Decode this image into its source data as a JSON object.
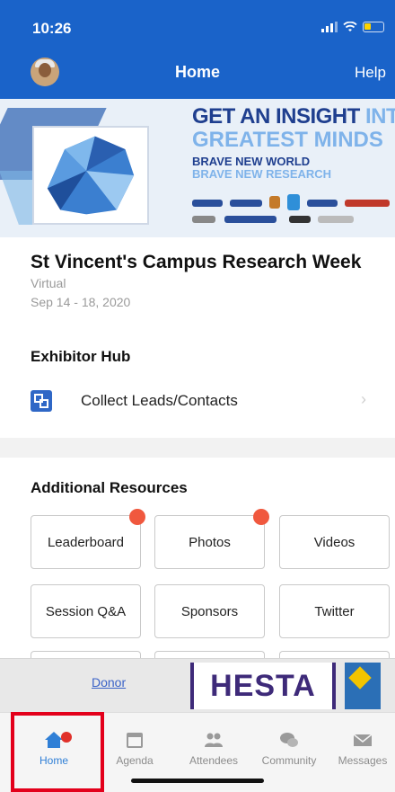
{
  "status_bar": {
    "time": "10:26"
  },
  "nav": {
    "title": "Home",
    "help_label": "Help"
  },
  "banner": {
    "line1_bold": "GET AN INSIGHT",
    "line1_light": "INTO OUR",
    "line2": "GREATEST MINDS",
    "line3": "BRAVE NEW WORLD",
    "line4": "BRAVE NEW RESEARCH"
  },
  "event": {
    "title": "St Vincent's Campus Research Week",
    "type": "Virtual",
    "date": "Sep 14 - 18, 2020"
  },
  "exhibitor_hub": {
    "title": "Exhibitor Hub",
    "collect_leads_label": "Collect Leads/Contacts"
  },
  "additional_resources": {
    "title": "Additional Resources",
    "buttons": [
      {
        "label": "Leaderboard",
        "badge": true
      },
      {
        "label": "Photos",
        "badge": true
      },
      {
        "label": "Videos",
        "badge": false
      },
      {
        "label": "Session Q&A",
        "badge": false
      },
      {
        "label": "Sponsors",
        "badge": false
      },
      {
        "label": "Twitter",
        "badge": false
      }
    ]
  },
  "ad_bar": {
    "donor_label": "Donor",
    "brand": "HESTA"
  },
  "tabbar": {
    "items": [
      {
        "label": "Home",
        "icon": "home-icon",
        "active": true
      },
      {
        "label": "Agenda",
        "icon": "calendar-icon",
        "active": false
      },
      {
        "label": "Attendees",
        "icon": "people-icon",
        "active": false
      },
      {
        "label": "Community",
        "icon": "community-icon",
        "active": false
      },
      {
        "label": "Messages",
        "icon": "envelope-icon",
        "active": false
      }
    ]
  },
  "colors": {
    "primary": "#1a63c9",
    "accent_badge": "#f0583e",
    "highlight_box": "#e3001b",
    "hesta_purple": "#3e2a79"
  }
}
